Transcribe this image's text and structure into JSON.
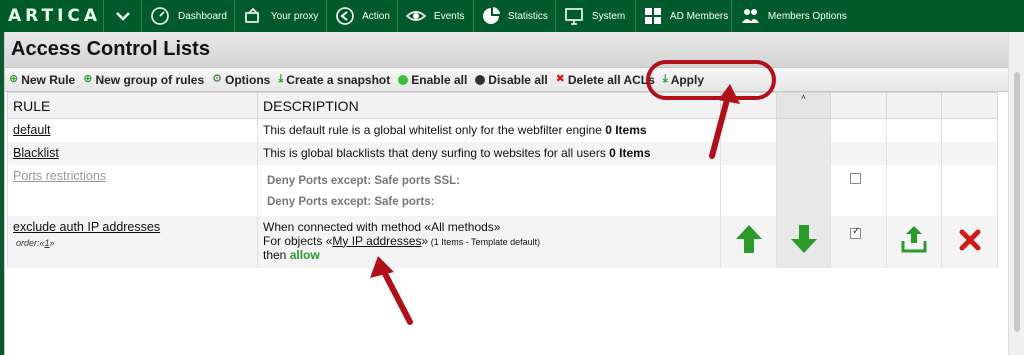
{
  "nav": {
    "logo": "ARTICA",
    "items": [
      {
        "label": "Dashboard",
        "icon": "dashboard-icon"
      },
      {
        "label": "Your proxy",
        "icon": "proxy-icon"
      },
      {
        "label": "Action",
        "icon": "action-icon"
      },
      {
        "label": "Events",
        "icon": "eye-icon"
      },
      {
        "label": "Statistics",
        "icon": "pie-chart-icon"
      },
      {
        "label": "System",
        "icon": "monitor-icon"
      },
      {
        "label": "AD Members",
        "icon": "windows-icon"
      },
      {
        "label": "Members Options",
        "icon": "members-icon"
      }
    ]
  },
  "page": {
    "title": "Access Control Lists"
  },
  "toolbar": {
    "new_rule": "New Rule",
    "new_group": "New group of rules",
    "options": "Options",
    "snapshot": "Create a snapshot",
    "enable_all": "Enable all",
    "disable_all": "Disable all",
    "delete_all": "Delete all ACLs",
    "apply": "Apply"
  },
  "table": {
    "headers": {
      "rule": "RULE",
      "description": "DESCRIPTION"
    },
    "rows": [
      {
        "rule": "default",
        "desc_text": "This default rule is a global whitelist only for the webfilter engine ",
        "desc_bold": "0 Items"
      },
      {
        "rule": "Blacklist",
        "desc_text": "This is global blacklists that deny surfing to websites for all users ",
        "desc_bold": "0 Items"
      },
      {
        "rule": "Ports restrictions",
        "deny1": "Deny Ports except: Safe ports SSL:",
        "deny2": "Deny Ports except: Safe ports:"
      },
      {
        "rule": "exclude auth IP addresses",
        "order": "order:«1»",
        "line1": "When connected with method «All methods»",
        "line2_prefix": "For objects «",
        "line2_link": "My IP addresses",
        "line2_suffix": "»",
        "line2_small": " (1 Items - Template default)",
        "line3_prefix": "then ",
        "line3_action": "allow"
      }
    ]
  },
  "colors": {
    "nav_bg": "#005a2b",
    "green": "#2a9a2a",
    "red": "#d11a1a",
    "annotation": "#b0101a"
  }
}
